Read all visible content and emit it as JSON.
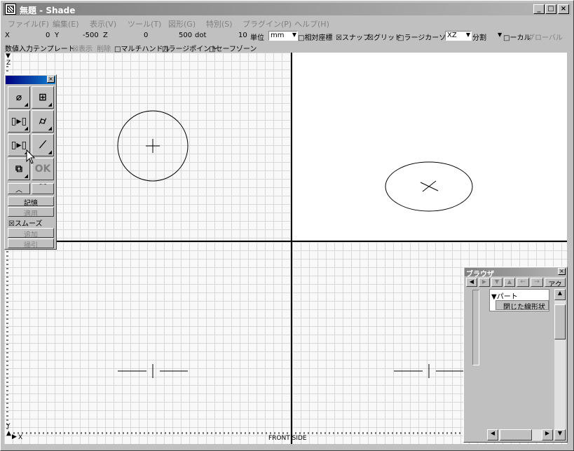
{
  "window": {
    "title": "無題 - Shade",
    "minimize": "_",
    "maximize": "□",
    "close": "×"
  },
  "menu": [
    "ファイル(F)",
    "編集(E)",
    "表示(V)",
    "ツール(T)",
    "図形(G)",
    "特別(S)",
    "プラグイン(P)",
    "ヘルプ(H)"
  ],
  "coords": {
    "x_label": "X",
    "x_value": "0",
    "y_label": "Y",
    "y_value": "-500",
    "z_label": "Z",
    "z_value": "0",
    "dot_value": "500",
    "dot_label": "dot",
    "unit_value": "10",
    "unit_label": "単位",
    "unit_select": "mm"
  },
  "toggles": {
    "relative": "□相対座標",
    "snap": "☒スナップ",
    "grid": "☒グリッド",
    "large_cursor": "□ラージカーソル",
    "plane": "XZ",
    "split": "分割",
    "local": "□ーカル",
    "global": "グローバル"
  },
  "toolbar2": {
    "numeric_template": "数値入力テンプレート",
    "display": "☒表示",
    "delete": "削除",
    "multi_handle": "□マルチハンドル",
    "large_point": "□ラージポイント",
    "safe_zone": "□セーフゾーン"
  },
  "tool_palette": {
    "ok_label": "OK",
    "memory": "記憶",
    "apply": "適用",
    "smooth": "☒スムーズ",
    "add": "追加",
    "subtract": "掃引"
  },
  "browser": {
    "title": "ブラウザ",
    "tab_label": "アク",
    "tree_root": "▼パート",
    "tree_child": "閉じた線形状"
  },
  "status": {
    "x_axis": "X",
    "y_axis": "Y",
    "z_axis": "Z",
    "view_label": "FRONT SIDE"
  },
  "colors": {
    "titlebar_inactive": "#808080",
    "panel_title_active": "#000080",
    "face": "#c0c0c0"
  }
}
